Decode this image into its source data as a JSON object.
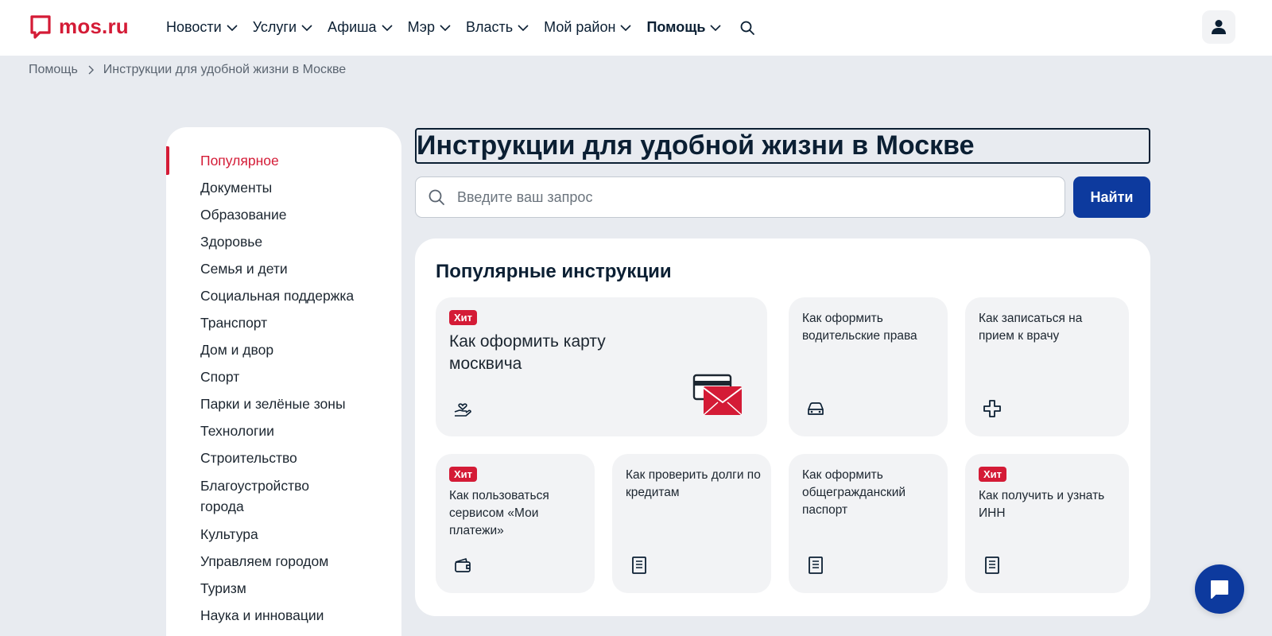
{
  "header": {
    "logo_text": "mos.ru",
    "brand_color": "#d41b36",
    "nav": [
      {
        "label": "Новости",
        "bold": false
      },
      {
        "label": "Услуги",
        "bold": false
      },
      {
        "label": "Афиша",
        "bold": false
      },
      {
        "label": "Мэр",
        "bold": false
      },
      {
        "label": "Власть",
        "bold": false
      },
      {
        "label": "Мой район",
        "bold": false
      },
      {
        "label": "Помощь",
        "bold": true
      }
    ],
    "search_icon": "search-icon",
    "profile_icon": "user-icon"
  },
  "breadcrumb": {
    "items": [
      "Помощь",
      "Инструкции для удобной жизни в Москве"
    ]
  },
  "sidebar": {
    "items": [
      {
        "label": "Популярное",
        "active": true
      },
      {
        "label": "Документы"
      },
      {
        "label": "Образование"
      },
      {
        "label": "Здоровье"
      },
      {
        "label": "Семья и дети"
      },
      {
        "label": "Социальная поддержка"
      },
      {
        "label": "Транспорт"
      },
      {
        "label": "Дом и двор"
      },
      {
        "label": "Спорт"
      },
      {
        "label": "Парки и зелёные зоны"
      },
      {
        "label": "Технологии"
      },
      {
        "label": "Строительство"
      },
      {
        "label": "Благоустройство города"
      },
      {
        "label": "Культура"
      },
      {
        "label": "Управляем городом"
      },
      {
        "label": "Туризм"
      },
      {
        "label": "Наука и инновации"
      }
    ]
  },
  "main": {
    "title": "Инструкции для удобной жизни в Москве",
    "search": {
      "placeholder": "Введите ваш запрос",
      "value": "",
      "button_label": "Найти",
      "button_color": "#0d3a9e"
    },
    "popular": {
      "title": "Популярные инструкции",
      "badge_label": "Хит",
      "cards": [
        {
          "title": "Как оформить карту москвича",
          "hit": true,
          "icon": "hand-heart-icon",
          "illustration": "card-envelope-illustration"
        },
        {
          "title": "Как оформить водительские права",
          "hit": false,
          "icon": "car-icon"
        },
        {
          "title": "Как записаться на прием к врачу",
          "hit": false,
          "icon": "medical-cross-icon"
        },
        {
          "title": "Как пользоваться сервисом «Мои платежи»",
          "hit": true,
          "icon": "wallet-icon"
        },
        {
          "title": "Как проверить долги по кредитам",
          "hit": false,
          "icon": "document-icon"
        },
        {
          "title": "Как оформить общегражданский паспорт",
          "hit": false,
          "icon": "document-icon"
        },
        {
          "title": "Как получить и узнать ИНН",
          "hit": true,
          "icon": "document-icon"
        }
      ]
    }
  },
  "chat": {
    "icon": "chat-bubble-icon"
  }
}
